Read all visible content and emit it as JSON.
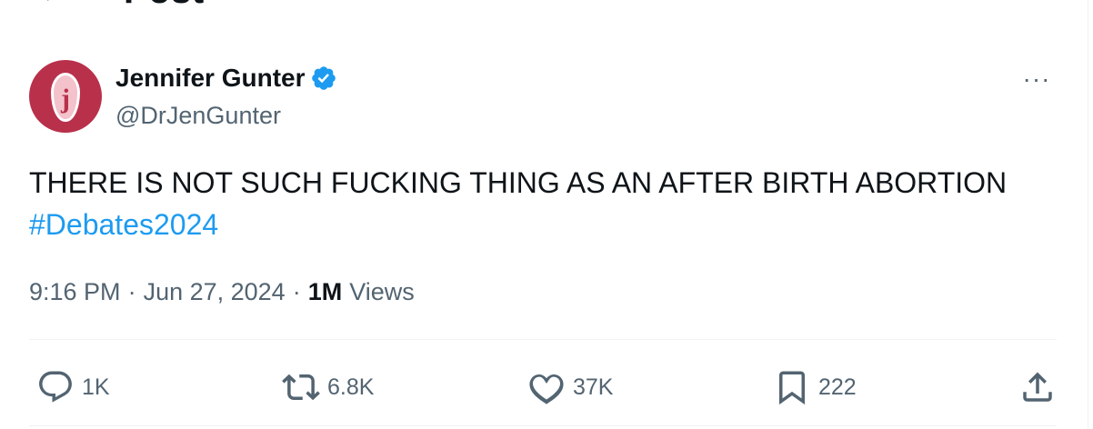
{
  "header": {
    "back_icon": "arrow-left-icon",
    "title": "Post"
  },
  "author": {
    "display_name": "Jennifer Gunter",
    "handle": "@DrJenGunter",
    "avatar_letter": "j",
    "avatar_color": "#b9304b",
    "verified_color": "#1d9bf0",
    "verified_icon": "verified-badge-icon",
    "more_icon": "more-horizontal-icon",
    "more_label": "···"
  },
  "tweet": {
    "text": "THERE IS NOT SUCH FUCKING THING AS AN AFTER BIRTH ABORTION",
    "hashtag": "#Debates2024",
    "hashtag_color": "#1d9bf0"
  },
  "meta": {
    "time": "9:16 PM",
    "separator": "·",
    "date": "Jun 27, 2024",
    "views_count": "1M",
    "views_label": "Views"
  },
  "actions": {
    "reply": {
      "icon": "reply-icon",
      "count": "1K"
    },
    "repost": {
      "icon": "repost-icon",
      "count": "6.8K"
    },
    "like": {
      "icon": "heart-icon",
      "count": "37K"
    },
    "bookmark": {
      "icon": "bookmark-icon",
      "count": "222"
    },
    "share": {
      "icon": "share-icon"
    }
  }
}
